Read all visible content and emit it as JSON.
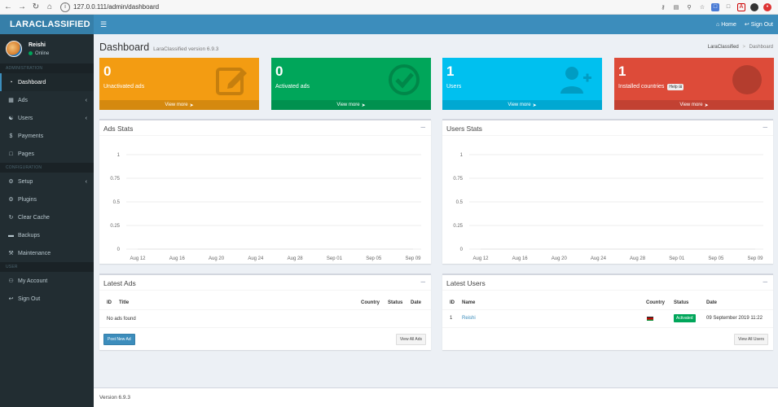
{
  "browser": {
    "url": "127.0.0.111/admin/dashboard"
  },
  "sidebar": {
    "brand": "LARACLASSIFIED",
    "user_name": "Reishi",
    "user_status": "Online",
    "headers": [
      "ADMINISTRATION",
      "CONFIGURATION",
      "USER"
    ],
    "items": [
      {
        "label": "Dashboard",
        "icon": "dashboard-icon"
      },
      {
        "label": "Ads",
        "icon": "table-icon"
      },
      {
        "label": "Users",
        "icon": "users-icon"
      },
      {
        "label": "Payments",
        "icon": "dollar-icon"
      },
      {
        "label": "Pages",
        "icon": "file-icon"
      },
      {
        "label": "Setup",
        "icon": "gear-icon"
      },
      {
        "label": "Plugins",
        "icon": "gears-icon"
      },
      {
        "label": "Clear Cache",
        "icon": "refresh-icon"
      },
      {
        "label": "Backups",
        "icon": "hdd-icon"
      },
      {
        "label": "Maintenance",
        "icon": "wrench-icon"
      },
      {
        "label": "My Account",
        "icon": "user-icon"
      },
      {
        "label": "Sign Out",
        "icon": "sign-out-icon"
      }
    ]
  },
  "topbar": {
    "home_label": "Home",
    "signout_label": "Sign Out"
  },
  "header": {
    "title": "Dashboard",
    "subtitle": "LaraClassified version 6.9.3",
    "breadcrumb_root": "LaraClassified",
    "breadcrumb_current": "Dashboard"
  },
  "stats": [
    {
      "value": "0",
      "label": "Unactivated ads",
      "footer": "View more",
      "color": "#f39c12"
    },
    {
      "value": "0",
      "label": "Activated ads",
      "footer": "View more",
      "color": "#00a65a"
    },
    {
      "value": "1",
      "label": "Users",
      "footer": "View more",
      "color": "#00c0ef"
    },
    {
      "value": "1",
      "label": "Installed countries",
      "help": "Help",
      "footer": "View more",
      "color": "#dd4b39"
    }
  ],
  "ads_stats": {
    "title": "Ads Stats"
  },
  "users_stats": {
    "title": "Users Stats"
  },
  "chart_data": [
    {
      "type": "line",
      "title": "Ads Stats",
      "x": [
        "Aug 12",
        "Aug 16",
        "Aug 20",
        "Aug 24",
        "Aug 28",
        "Sep 01",
        "Sep 05",
        "Sep 09"
      ],
      "yticks": [
        "0",
        "0.25",
        "0.5",
        "0.75",
        "1"
      ],
      "ylim": [
        0,
        1
      ],
      "series": [
        {
          "values": [
            0,
            0,
            0,
            0,
            0,
            0,
            0,
            0
          ]
        }
      ],
      "grid": true
    },
    {
      "type": "line",
      "title": "Users Stats",
      "x": [
        "Aug 12",
        "Aug 16",
        "Aug 20",
        "Aug 24",
        "Aug 28",
        "Sep 01",
        "Sep 05",
        "Sep 09"
      ],
      "yticks": [
        "0",
        "0.25",
        "0.5",
        "0.75",
        "1"
      ],
      "ylim": [
        0,
        1
      ],
      "series": [
        {
          "values": [
            0,
            0,
            0,
            0,
            0,
            0,
            0,
            0
          ]
        }
      ],
      "grid": true
    }
  ],
  "latest_ads": {
    "title": "Latest Ads",
    "columns": [
      "ID",
      "Title",
      "Country",
      "Status",
      "Date"
    ],
    "empty_text": "No ads found",
    "post_button": "Post New Ad",
    "view_all": "View All Ads"
  },
  "latest_users": {
    "title": "Latest Users",
    "columns": [
      "ID",
      "Name",
      "Country",
      "Status",
      "Date"
    ],
    "rows": [
      {
        "id": "1",
        "name": "Reishi",
        "status": "Activated",
        "date": "09 September 2019 11:22"
      }
    ],
    "view_all": "View All Users"
  },
  "footer": {
    "version": "Version 6.9.3"
  },
  "colors": {
    "primary": "#3c8dbc",
    "sidebar": "#222d32"
  }
}
